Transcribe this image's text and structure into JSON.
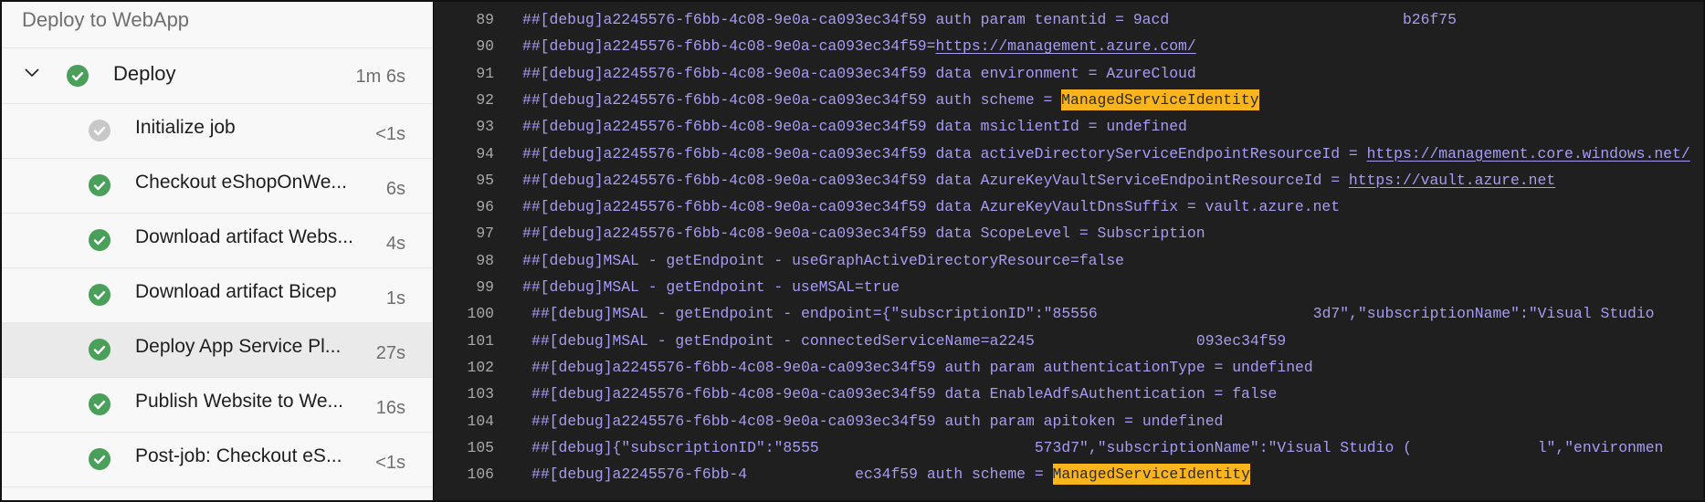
{
  "stage": {
    "title": "Deploy to WebApp"
  },
  "job": {
    "name": "Deploy",
    "duration": "1m 6s",
    "status": "success",
    "expanded": true
  },
  "steps": [
    {
      "label": "Initialize job",
      "duration": "<1s",
      "status": "skipped"
    },
    {
      "label": "Checkout eShopOnWe...",
      "duration": "6s",
      "status": "success"
    },
    {
      "label": "Download artifact Webs...",
      "duration": "4s",
      "status": "success"
    },
    {
      "label": "Download artifact Bicep",
      "duration": "1s",
      "status": "success"
    },
    {
      "label": "Deploy App Service Pl...",
      "duration": "27s",
      "status": "success",
      "selected": true
    },
    {
      "label": "Publish Website to We...",
      "duration": "16s",
      "status": "success"
    },
    {
      "label": "Post-job: Checkout eS...",
      "duration": "<1s",
      "status": "success"
    }
  ],
  "colors": {
    "success": "#4aa05b",
    "skipped": "#c8c8c8",
    "log_text": "#a79cf2",
    "highlight": "#f9b51b"
  },
  "log": {
    "lines": [
      {
        "n": "89",
        "segments": [
          {
            "t": "##[debug]a2245576-f6bb-4c08-9e0a-ca093ec34f59 auth param tenantid = 9acd"
          },
          {
            "t": "                          ",
            "type": "gap"
          },
          {
            "t": "b26f75"
          }
        ]
      },
      {
        "n": "90",
        "segments": [
          {
            "t": "##[debug]a2245576-f6bb-4c08-9e0a-ca093ec34f59="
          },
          {
            "t": "https://management.azure.com/",
            "type": "link"
          }
        ]
      },
      {
        "n": "91",
        "segments": [
          {
            "t": "##[debug]a2245576-f6bb-4c08-9e0a-ca093ec34f59 data environment = AzureCloud"
          }
        ]
      },
      {
        "n": "92",
        "segments": [
          {
            "t": "##[debug]a2245576-f6bb-4c08-9e0a-ca093ec34f59 auth scheme = "
          },
          {
            "t": "ManagedServiceIdentity",
            "type": "hl"
          }
        ]
      },
      {
        "n": "93",
        "segments": [
          {
            "t": "##[debug]a2245576-f6bb-4c08-9e0a-ca093ec34f59 data msiclientId = undefined"
          }
        ]
      },
      {
        "n": "94",
        "segments": [
          {
            "t": "##[debug]a2245576-f6bb-4c08-9e0a-ca093ec34f59 data activeDirectoryServiceEndpointResourceId = "
          },
          {
            "t": "https://management.core.windows.net/",
            "type": "link"
          }
        ]
      },
      {
        "n": "95",
        "segments": [
          {
            "t": "##[debug]a2245576-f6bb-4c08-9e0a-ca093ec34f59 data AzureKeyVaultServiceEndpointResourceId = "
          },
          {
            "t": "https://vault.azure.net",
            "type": "link"
          }
        ]
      },
      {
        "n": "96",
        "segments": [
          {
            "t": "##[debug]a2245576-f6bb-4c08-9e0a-ca093ec34f59 data AzureKeyVaultDnsSuffix = vault.azure.net"
          }
        ]
      },
      {
        "n": "97",
        "segments": [
          {
            "t": "##[debug]a2245576-f6bb-4c08-9e0a-ca093ec34f59 data ScopeLevel = Subscription"
          }
        ]
      },
      {
        "n": "98",
        "segments": [
          {
            "t": "##[debug]MSAL - getEndpoint - useGraphActiveDirectoryResource=false"
          }
        ]
      },
      {
        "n": "99",
        "segments": [
          {
            "t": "##[debug]MSAL - getEndpoint - useMSAL=true"
          }
        ]
      },
      {
        "n": "100",
        "segments": [
          {
            "t": "##[debug]MSAL - getEndpoint - endpoint={\"subscriptionID\":\"85556"
          },
          {
            "t": "                        ",
            "type": "gap"
          },
          {
            "t": "3d7\",\"subscriptionName\":\"Visual Studio "
          }
        ]
      },
      {
        "n": "101",
        "segments": [
          {
            "t": "##[debug]MSAL - getEndpoint - connectedServiceName=a2245"
          },
          {
            "t": "                  ",
            "type": "gap"
          },
          {
            "t": "093ec34f59"
          }
        ]
      },
      {
        "n": "102",
        "segments": [
          {
            "t": "##[debug]a2245576-f6bb-4c08-9e0a-ca093ec34f59 auth param authenticationType = undefined"
          }
        ]
      },
      {
        "n": "103",
        "segments": [
          {
            "t": "##[debug]a2245576-f6bb-4c08-9e0a-ca093ec34f59 data EnableAdfsAuthentication = false"
          }
        ]
      },
      {
        "n": "104",
        "segments": [
          {
            "t": "##[debug]a2245576-f6bb-4c08-9e0a-ca093ec34f59 auth param apitoken = undefined"
          }
        ]
      },
      {
        "n": "105",
        "segments": [
          {
            "t": "##[debug]{\"subscriptionID\":\"8555"
          },
          {
            "t": "                        ",
            "type": "gap"
          },
          {
            "t": "573d7\",\"subscriptionName\":\"Visual Studio ("
          },
          {
            "t": "              ",
            "type": "gap"
          },
          {
            "t": "l\",\"environmen"
          }
        ]
      },
      {
        "n": "106",
        "segments": [
          {
            "t": "##[debug]a2245576-f6bb-4"
          },
          {
            "t": "            ",
            "type": "gap"
          },
          {
            "t": "ec34f59 auth scheme = "
          },
          {
            "t": "ManagedServiceIdentity",
            "type": "hl"
          }
        ]
      }
    ]
  }
}
